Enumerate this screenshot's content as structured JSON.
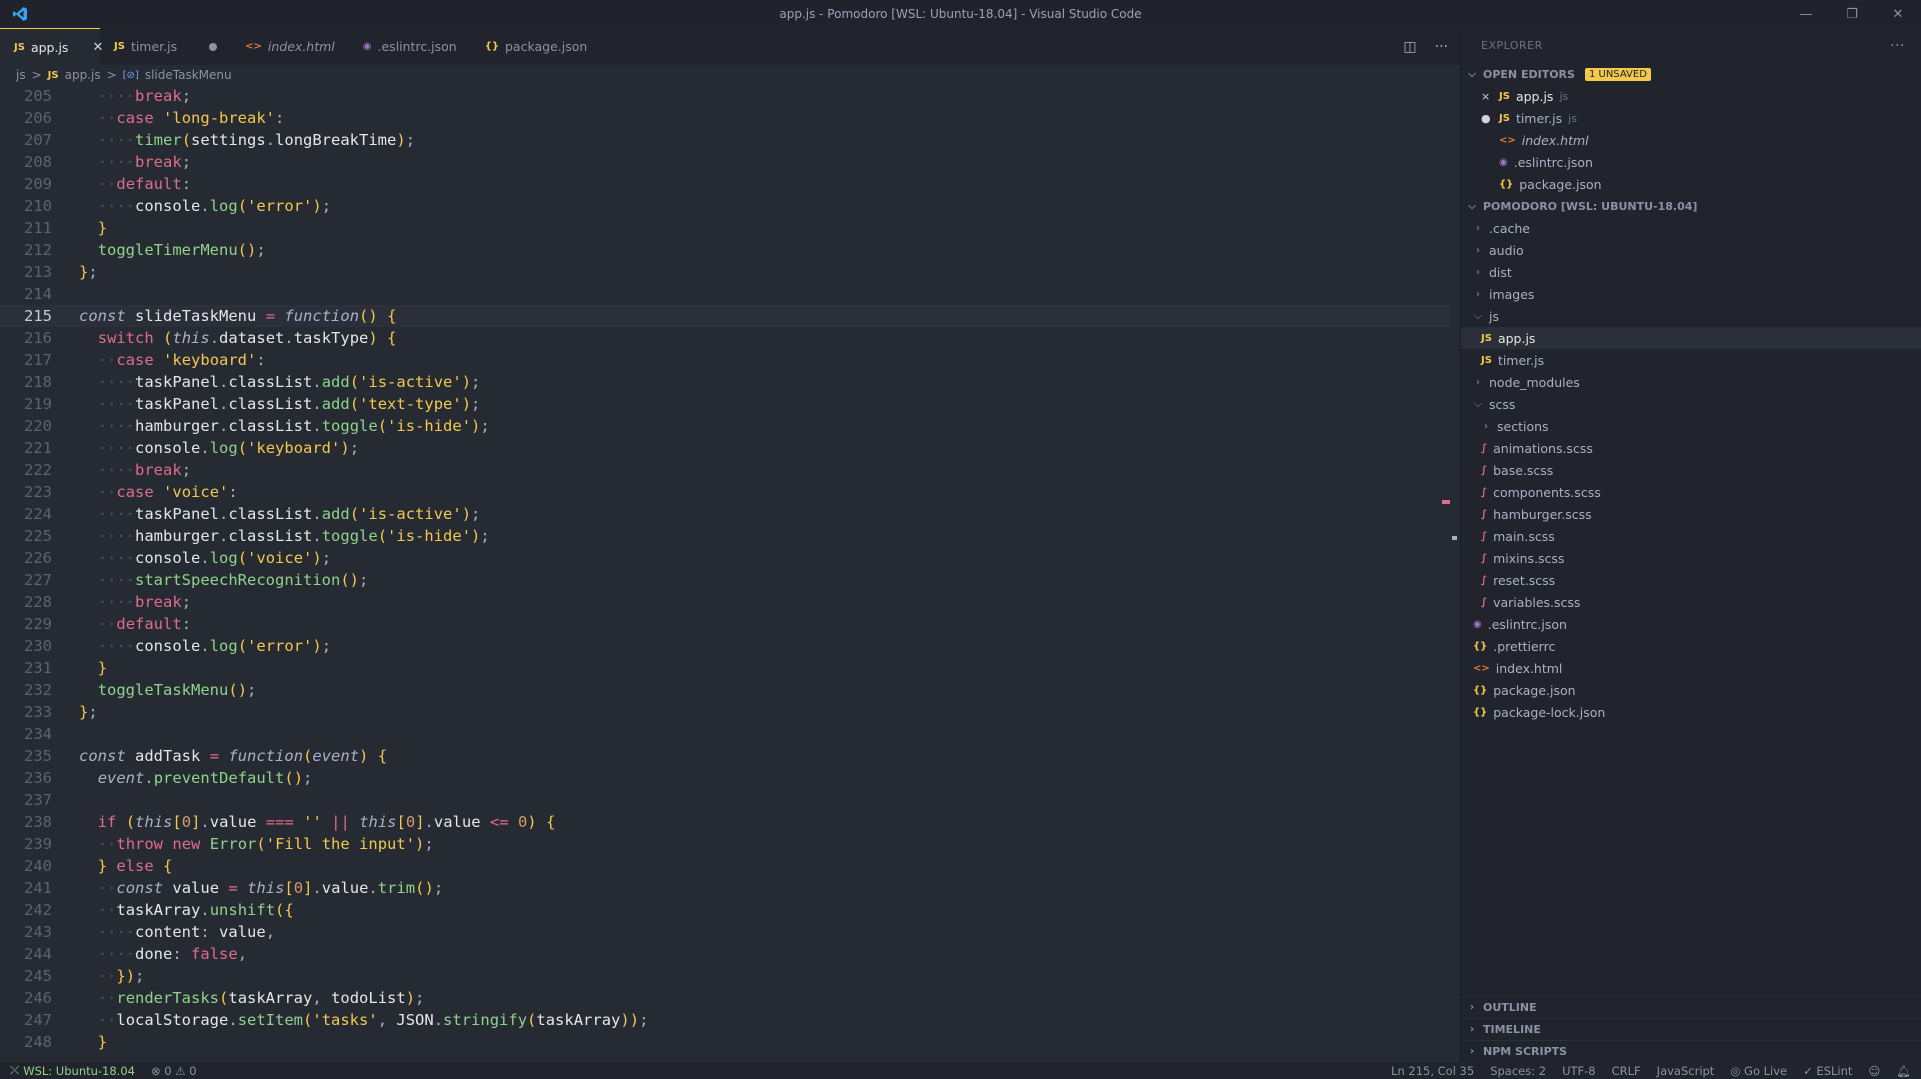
{
  "window": {
    "title": "app.js - Pomodoro [WSL: Ubuntu-18.04] - Visual Studio Code",
    "min_icon": "minimize-icon",
    "max_icon": "restore-icon",
    "close_icon": "close-icon"
  },
  "tabs": [
    {
      "icon": "JS",
      "label": "app.js",
      "state": "active"
    },
    {
      "icon": "JS",
      "label": "timer.js",
      "state": "modified"
    },
    {
      "icon": "<>",
      "label": "index.html",
      "state": "preview"
    },
    {
      "icon": "◉",
      "label": ".eslintrc.json",
      "state": "normal"
    },
    {
      "icon": "{}",
      "label": "package.json",
      "state": "normal"
    }
  ],
  "breadcrumb": {
    "folder": "js",
    "file_icon": "JS",
    "file": "app.js",
    "symbol_icon": "[⊘]",
    "symbol": "slideTaskMenu",
    "sep": ">"
  },
  "editor": {
    "current_line": 215,
    "lines": [
      {
        "n": "205",
        "code": "  ····break;"
      },
      {
        "n": "206",
        "code": "  ··case 'long-break':"
      },
      {
        "n": "207",
        "code": "  ····timer(settings.longBreakTime);"
      },
      {
        "n": "208",
        "code": "  ····break;"
      },
      {
        "n": "209",
        "code": "  ··default:"
      },
      {
        "n": "210",
        "code": "  ····console.log('error');"
      },
      {
        "n": "211",
        "code": "  }"
      },
      {
        "n": "212",
        "code": "  toggleTimerMenu();"
      },
      {
        "n": "213",
        "code": "};"
      },
      {
        "n": "214",
        "code": ""
      },
      {
        "n": "215",
        "code": "const slideTaskMenu = function() {"
      },
      {
        "n": "216",
        "code": "  switch (this.dataset.taskType) {"
      },
      {
        "n": "217",
        "code": "  ··case 'keyboard':"
      },
      {
        "n": "218",
        "code": "  ····taskPanel.classList.add('is-active');"
      },
      {
        "n": "219",
        "code": "  ····taskPanel.classList.add('text-type');"
      },
      {
        "n": "220",
        "code": "  ····hamburger.classList.toggle('is-hide');"
      },
      {
        "n": "221",
        "code": "  ····console.log('keyboard');"
      },
      {
        "n": "222",
        "code": "  ····break;"
      },
      {
        "n": "223",
        "code": "  ··case 'voice':"
      },
      {
        "n": "224",
        "code": "  ····taskPanel.classList.add('is-active');"
      },
      {
        "n": "225",
        "code": "  ····hamburger.classList.toggle('is-hide');"
      },
      {
        "n": "226",
        "code": "  ····console.log('voice');"
      },
      {
        "n": "227",
        "code": "  ····startSpeechRecognition();"
      },
      {
        "n": "228",
        "code": "  ····break;"
      },
      {
        "n": "229",
        "code": "  ··default:"
      },
      {
        "n": "230",
        "code": "  ····console.log('error');"
      },
      {
        "n": "231",
        "code": "  }"
      },
      {
        "n": "232",
        "code": "  toggleTaskMenu();"
      },
      {
        "n": "233",
        "code": "};"
      },
      {
        "n": "234",
        "code": ""
      },
      {
        "n": "235",
        "code": "const addTask = function(event) {"
      },
      {
        "n": "236",
        "code": "  event.preventDefault();"
      },
      {
        "n": "237",
        "code": ""
      },
      {
        "n": "238",
        "code": "  if (this[0].value === '' || this[0].value <= 0) {"
      },
      {
        "n": "239",
        "code": "  ··throw new Error('Fill the input');"
      },
      {
        "n": "240",
        "code": "  } else {"
      },
      {
        "n": "241",
        "code": "  ··const value = this[0].value.trim();"
      },
      {
        "n": "242",
        "code": "  ··taskArray.unshift({"
      },
      {
        "n": "243",
        "code": "  ····content: value,"
      },
      {
        "n": "244",
        "code": "  ····done: false,"
      },
      {
        "n": "245",
        "code": "  ··});"
      },
      {
        "n": "246",
        "code": "  ··renderTasks(taskArray, todoList);"
      },
      {
        "n": "247",
        "code": "  ··localStorage.setItem('tasks', JSON.stringify(taskArray));"
      },
      {
        "n": "248",
        "code": "  }"
      }
    ]
  },
  "explorer": {
    "header": "EXPLORER",
    "more_icon": "ellipsis-icon",
    "open_editors": {
      "title": "OPEN EDITORS",
      "badge": "1 UNSAVED",
      "items": [
        {
          "mark": "×",
          "icon": "JS",
          "name": "app.js",
          "sub": "js"
        },
        {
          "mark": "●",
          "icon": "JS",
          "name": "timer.js",
          "sub": "js"
        },
        {
          "mark": "",
          "icon": "<>",
          "name": "index.html",
          "sub": ""
        },
        {
          "mark": "",
          "icon": "◉",
          "name": ".eslintrc.json",
          "sub": ""
        },
        {
          "mark": "",
          "icon": "{}",
          "name": "package.json",
          "sub": ""
        }
      ]
    },
    "project": {
      "title": "POMODORO [WSL: UBUNTU-18.04]",
      "tree": [
        {
          "depth": 0,
          "type": "folder",
          "open": false,
          "name": ".cache"
        },
        {
          "depth": 0,
          "type": "folder",
          "open": false,
          "name": "audio"
        },
        {
          "depth": 0,
          "type": "folder",
          "open": false,
          "name": "dist"
        },
        {
          "depth": 0,
          "type": "folder",
          "open": false,
          "name": "images"
        },
        {
          "depth": 0,
          "type": "folder",
          "open": true,
          "name": "js"
        },
        {
          "depth": 1,
          "type": "js",
          "name": "app.js",
          "selected": true
        },
        {
          "depth": 1,
          "type": "js",
          "name": "timer.js"
        },
        {
          "depth": 0,
          "type": "folder",
          "open": false,
          "name": "node_modules"
        },
        {
          "depth": 0,
          "type": "folder",
          "open": true,
          "name": "scss"
        },
        {
          "depth": 1,
          "type": "folder",
          "open": false,
          "name": "sections"
        },
        {
          "depth": 1,
          "type": "scss",
          "name": "animations.scss"
        },
        {
          "depth": 1,
          "type": "scss",
          "name": "base.scss"
        },
        {
          "depth": 1,
          "type": "scss",
          "name": "components.scss"
        },
        {
          "depth": 1,
          "type": "scss",
          "name": "hamburger.scss"
        },
        {
          "depth": 1,
          "type": "scss",
          "name": "main.scss"
        },
        {
          "depth": 1,
          "type": "scss",
          "name": "mixins.scss"
        },
        {
          "depth": 1,
          "type": "scss",
          "name": "reset.scss"
        },
        {
          "depth": 1,
          "type": "scss",
          "name": "variables.scss"
        },
        {
          "depth": 0,
          "type": "eslint",
          "name": ".eslintrc.json"
        },
        {
          "depth": 0,
          "type": "json",
          "name": ".prettierrc"
        },
        {
          "depth": 0,
          "type": "html",
          "name": "index.html"
        },
        {
          "depth": 0,
          "type": "json",
          "name": "package.json"
        },
        {
          "depth": 0,
          "type": "json",
          "name": "package-lock.json"
        }
      ]
    },
    "bottom_sections": [
      "OUTLINE",
      "TIMELINE",
      "NPM SCRIPTS"
    ]
  },
  "statusbar": {
    "remote": "WSL: Ubuntu-18.04",
    "problems": "⊗ 0 ⚠ 0",
    "position": "Ln 215, Col 35",
    "spaces": "Spaces: 2",
    "encoding": "UTF-8",
    "eol": "CRLF",
    "language": "JavaScript",
    "golive": "Go Live",
    "eslint": "ESLint"
  },
  "colors": {
    "accent": "#f2c94c",
    "keyword": "#e06c8a",
    "function": "#8fd38b",
    "string": "#f2c94c",
    "background": "#262a33"
  }
}
